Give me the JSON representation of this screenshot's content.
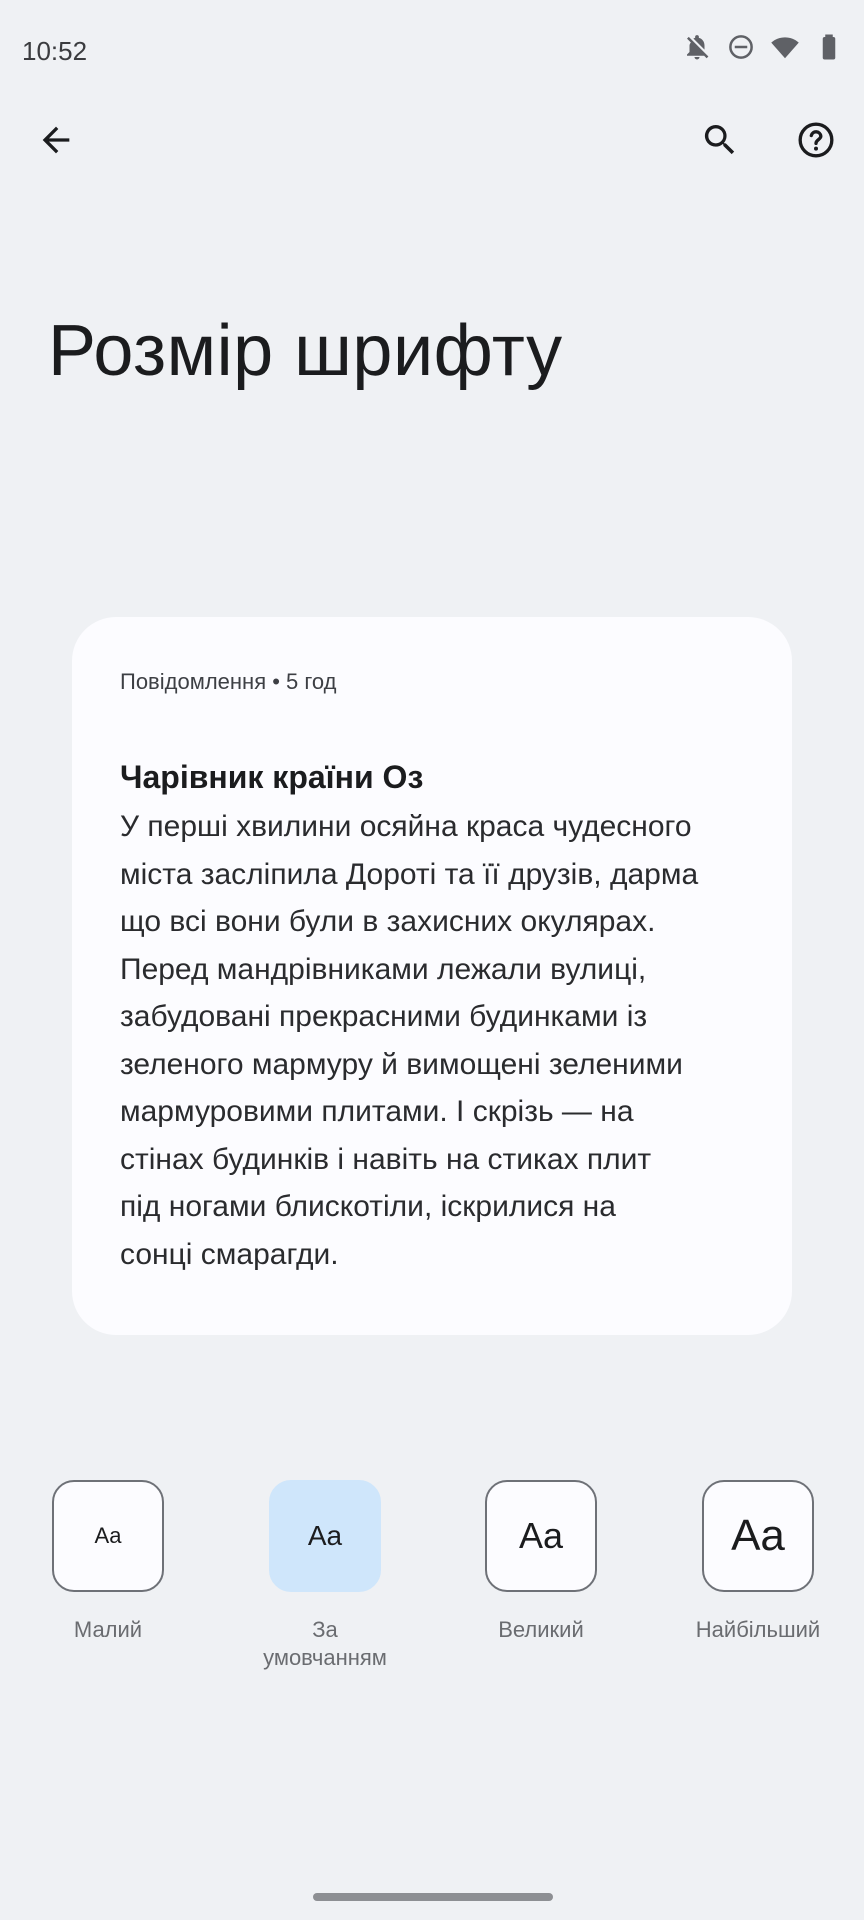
{
  "status_bar": {
    "time": "10:52",
    "icons": [
      "notifications-off-icon",
      "do-not-disturb-icon",
      "wifi-icon",
      "battery-icon"
    ]
  },
  "app_bar": {
    "back_icon": "arrow-back-icon",
    "search_icon": "search-icon",
    "help_icon": "help-icon"
  },
  "page": {
    "title": "Розмір шрифту"
  },
  "preview": {
    "meta": "Повідомлення • 5 год",
    "title": "Чарівник країни Оз",
    "body_lines": [
      "У перші хвилини осяйна краса чудесного",
      "міста засліпила Дороті та її друзів, дарма",
      "що всі вони були в захисних окулярах.",
      "Перед мандрівниками лежали вулиці,",
      "забудовані прекрасними будинками із",
      "зеленого мармуру й вимощені зеленими",
      "мармуровими плитами. І скрізь — на",
      "стінах будинків і навіть на стиках плит",
      "під ногами блискотіли, іскрилися на",
      "сонці смарагди."
    ]
  },
  "sizes": [
    {
      "sample": "Aa",
      "label_lines": [
        "Малий"
      ],
      "selected": false
    },
    {
      "sample": "Aa",
      "label_lines": [
        "За",
        "умовчанням"
      ],
      "selected": true
    },
    {
      "sample": "Aa",
      "label_lines": [
        "Великий"
      ],
      "selected": false
    },
    {
      "sample": "Aa",
      "label_lines": [
        "Найбільший"
      ],
      "selected": false
    }
  ],
  "colors": {
    "background": "#eff1f4",
    "card": "#fcfcff",
    "selected": "#cfe6fb",
    "outline": "#6e7177"
  }
}
